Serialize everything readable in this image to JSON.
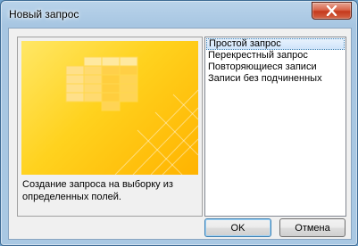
{
  "window": {
    "title": "Новый запрос"
  },
  "preview": {
    "description": "Создание запроса на выборку из определенных полей."
  },
  "query_types": [
    {
      "label": "Простой запрос",
      "selected": true
    },
    {
      "label": "Перекрестный запрос",
      "selected": false
    },
    {
      "label": "Повторяющиеся записи",
      "selected": false
    },
    {
      "label": "Записи без подчиненных",
      "selected": false
    }
  ],
  "buttons": {
    "ok_label": "OK",
    "cancel_label": "Отмена"
  },
  "icons": {
    "close": "close-icon",
    "preview": "query-wizard-illustration"
  },
  "colors": {
    "accent": "#3c7fb1",
    "close_button": "#c5391c",
    "preview_yellow": "#ffd21e"
  }
}
